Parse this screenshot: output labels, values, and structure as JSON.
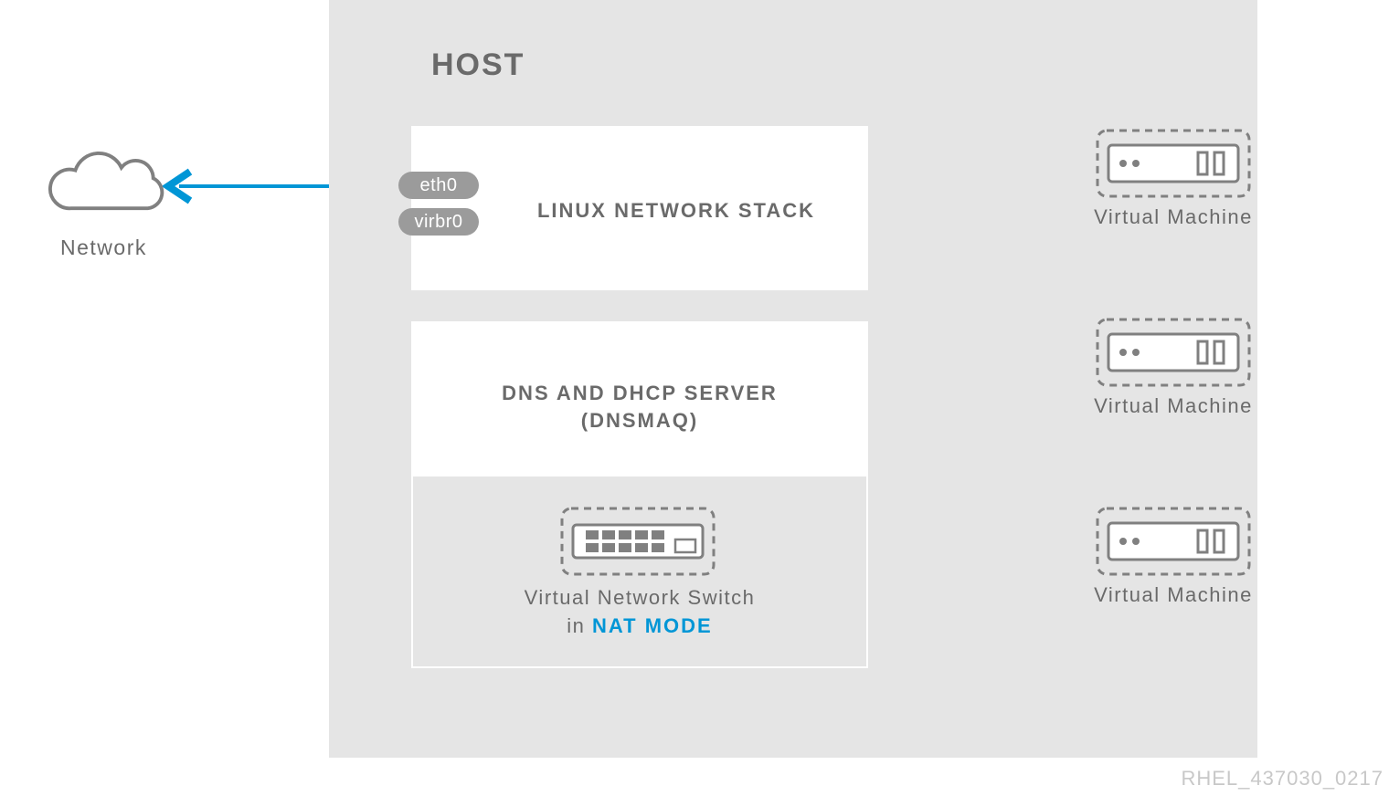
{
  "host": {
    "title": "HOST"
  },
  "network": {
    "label": "Network"
  },
  "linux_stack": {
    "label": "LINUX NETWORK STACK",
    "ports": {
      "eth0": "eth0",
      "virbr0": "virbr0"
    }
  },
  "dns": {
    "label_line1": "DNS AND DHCP SERVER",
    "label_line2": "(DNSMAQ)"
  },
  "switch": {
    "label_line1": "Virtual Network Switch",
    "label_line2_prefix": "in ",
    "label_line2_mode": "NAT MODE"
  },
  "vms": {
    "vm1": "Virtual Machine",
    "vm2": "Virtual Machine",
    "vm3": "Virtual Machine"
  },
  "footer": {
    "ref": "RHEL_437030_0217"
  },
  "colors": {
    "accent": "#0096d6",
    "grey": "#6a6a6a",
    "light_grey": "#e5e5e5",
    "tag_bg": "#9b9b9b"
  }
}
